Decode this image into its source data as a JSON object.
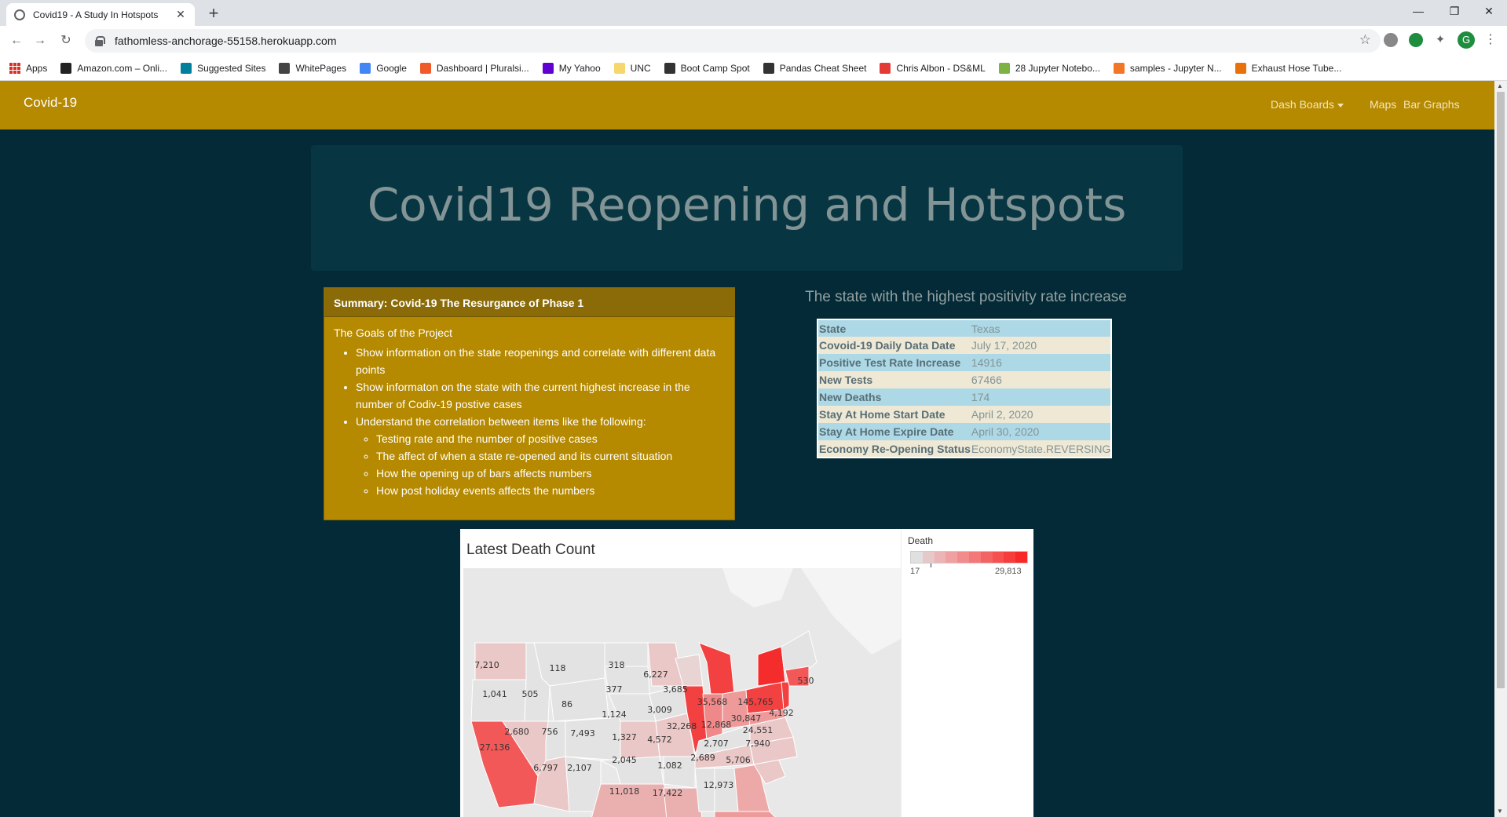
{
  "browser": {
    "tab_title": "Covid19 - A Study In Hotspots",
    "url": "fathomless-anchorage-55158.herokuapp.com",
    "profile_initial": "G",
    "bookmarks": [
      {
        "label": "Apps",
        "icon": "apps-grid-icon",
        "color": "#d93025"
      },
      {
        "label": "Amazon.com – Onli...",
        "icon": "amazon-icon",
        "color": "#222222"
      },
      {
        "label": "Suggested Sites",
        "icon": "bing-icon",
        "color": "#00809d"
      },
      {
        "label": "WhitePages",
        "icon": "whitepages-icon",
        "color": "#444444"
      },
      {
        "label": "Google",
        "icon": "google-icon",
        "color": "#4285f4"
      },
      {
        "label": "Dashboard | Pluralsi...",
        "icon": "pluralsight-icon",
        "color": "#f15b2a"
      },
      {
        "label": "My Yahoo",
        "icon": "yahoo-icon",
        "color": "#6001d2"
      },
      {
        "label": "UNC",
        "icon": "folder-icon",
        "color": "#f5d76e"
      },
      {
        "label": "Boot Camp Spot",
        "icon": "bootcamp-icon",
        "color": "#333333"
      },
      {
        "label": "Pandas Cheat Sheet",
        "icon": "github-icon",
        "color": "#333333"
      },
      {
        "label": "Chris Albon - DS&ML",
        "icon": "chrisalbon-icon",
        "color": "#e53935"
      },
      {
        "label": "28 Jupyter Notebo...",
        "icon": "rainbow-icon",
        "color": "#7cb342"
      },
      {
        "label": "samples - Jupyter N...",
        "icon": "jupyter-icon",
        "color": "#f37626"
      },
      {
        "label": "Exhaust Hose Tube...",
        "icon": "exhaust-icon",
        "color": "#e8710a"
      }
    ]
  },
  "navbar": {
    "brand": "Covid-19",
    "links": [
      "Dash Boards",
      "Maps",
      "Bar Graphs"
    ]
  },
  "jumbotron": {
    "title": "Covid19 Reopening and Hotspots"
  },
  "summary": {
    "header": "Summary: Covid-19 The Resurgance of Phase 1",
    "goals_title": "The Goals of the Project",
    "items": [
      "Show information on the state reopenings and correlate with different data points",
      "Show informaton on the state with the current highest increase in the number of Codiv-19 postive cases",
      "Understand the correlation between items like the following:"
    ],
    "subitems": [
      "Testing rate and the number of positive cases",
      "The affect of when a state re-opened and its current situation",
      "How the opening up of bars affects numbers",
      "How post holiday events affects the numbers"
    ]
  },
  "positivity": {
    "title": "The state with the highest positivity rate increase",
    "rows": [
      {
        "key": "State",
        "value": "Texas"
      },
      {
        "key": "Covoid-19 Daily Data Date",
        "value": "July 17, 2020"
      },
      {
        "key": "Positive Test Rate Increase",
        "value": "14916"
      },
      {
        "key": "New Tests",
        "value": "67466"
      },
      {
        "key": "New Deaths",
        "value": "174"
      },
      {
        "key": "Stay At Home Start Date",
        "value": "April 2, 2020"
      },
      {
        "key": "Stay At Home Expire Date",
        "value": "April 30, 2020"
      },
      {
        "key": "Economy Re-Opening Status",
        "value": "EconomyState.REVERSING"
      }
    ]
  },
  "death_map": {
    "title": "Latest Death Count",
    "legend_title": "Death",
    "legend_min": "17",
    "legend_max": "29,813",
    "legend_colors": [
      "#e0e0e0",
      "#e6c8c8",
      "#ecb4b4",
      "#f0a0a0",
      "#f28c8c",
      "#f47878",
      "#f56464",
      "#f65050",
      "#f73c3c",
      "#f82828"
    ],
    "state_labels": [
      "7,210",
      "118",
      "318",
      "6,227",
      "1,041",
      "505",
      "377",
      "3,685",
      "530",
      "86",
      "35,568",
      "145,765",
      "3,009",
      "1,124",
      "30,847",
      "4,192",
      "2,680",
      "756",
      "7,493",
      "32,268",
      "12,868",
      "24,551",
      "1,327",
      "4,572",
      "2,707",
      "7,940",
      "27,136",
      "2,689",
      "2,045",
      "5,706",
      "6,797",
      "2,107",
      "1,082",
      "12,973",
      "11,018",
      "17,422"
    ]
  }
}
